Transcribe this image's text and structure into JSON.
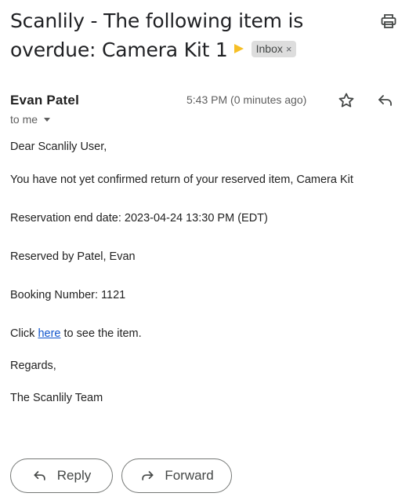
{
  "header": {
    "subject": "Scanlily - The following item is overdue: Camera Kit 1",
    "importance_icon": "importance-marker-icon",
    "label_chip": "Inbox",
    "label_remove": "×",
    "print_icon": "print-icon"
  },
  "message": {
    "sender": "Evan Patel",
    "recipient": "to me",
    "timestamp": "5:43 PM (0 minutes ago)",
    "star_icon": "star-icon",
    "reply_icon": "reply-icon"
  },
  "body": {
    "greeting": "Dear Scanlily User,",
    "line1": "You have not yet confirmed return of your reserved item, Camera Kit",
    "line2": "Reservation end date: 2023-04-24 13:30 PM (EDT)",
    "line3": "Reserved by Patel, Evan",
    "line4": "Booking Number: 1121",
    "click_prefix": "Click",
    "click_link": "here",
    "click_suffix": "to see the item.",
    "regards": "Regards,",
    "signature": "The Scanlily Team"
  },
  "actions": {
    "reply_label": "Reply",
    "forward_label": "Forward"
  },
  "colors": {
    "importance": "#f6bf26",
    "link": "#1155cc",
    "chip_bg": "#dddddd"
  }
}
